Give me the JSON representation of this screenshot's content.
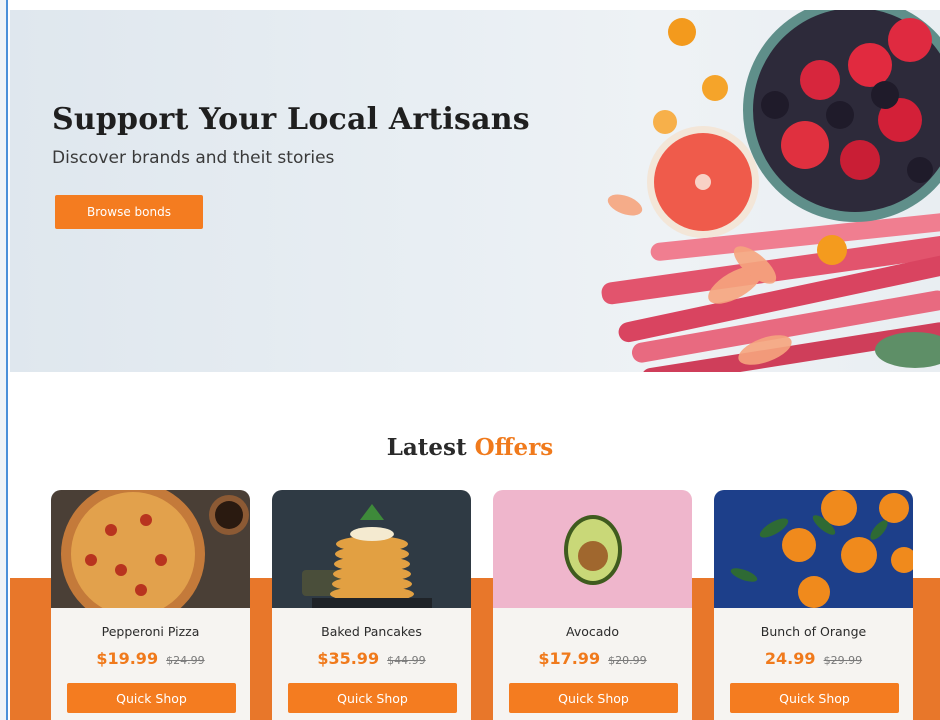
{
  "hero": {
    "title": "Support Your Local Artisans",
    "subtitle": "Discover brands and theit stories",
    "button_label": "Browse bonds"
  },
  "section": {
    "title_prefix": "Latest",
    "title_accent": "Offers"
  },
  "colors": {
    "accent": "#f47c20",
    "band": "#e8772a",
    "hero_bg": "#e6edf2"
  },
  "products": [
    {
      "name": "Pepperoni Pizza",
      "price": "$19.99",
      "old_price": "$24.99",
      "button_label": "Quick Shop",
      "image": "pizza-image"
    },
    {
      "name": "Baked Pancakes",
      "price": "$35.99",
      "old_price": "$44.99",
      "button_label": "Quick Shop",
      "image": "pancakes-image"
    },
    {
      "name": "Avocado",
      "price": "$17.99",
      "old_price": "$20.99",
      "button_label": "Quick Shop",
      "image": "avocado-image"
    },
    {
      "name": "Bunch of Orange",
      "price": "24.99",
      "old_price": "$29.99",
      "button_label": "Quick Shop",
      "image": "oranges-image"
    }
  ]
}
